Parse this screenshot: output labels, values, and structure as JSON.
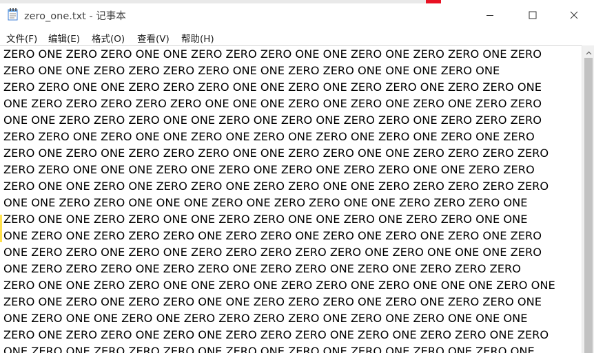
{
  "window": {
    "title": "zero_one.txt - 记事本",
    "controls": {
      "minimize_icon": "minimize-icon",
      "maximize_icon": "maximize-icon",
      "close_icon": "close-icon"
    }
  },
  "menu": [
    {
      "label": "文件(F)"
    },
    {
      "label": "编辑(E)"
    },
    {
      "label": "格式(O)"
    },
    {
      "label": "查看(V)"
    },
    {
      "label": "帮助(H)"
    }
  ],
  "editor": {
    "lines": [
      "ZERO ONE ZERO ZERO ONE ONE ZERO ZERO ZERO ONE ONE ZERO ONE ZERO ZERO ONE ZERO",
      "ZERO ONE ONE ZERO ZERO ZERO ZERO ONE ONE ZERO ZERO ONE ONE ONE ZERO ONE",
      "ZERO ZERO ONE ONE ZERO ZERO ZERO ONE ONE ZERO ONE ZERO ZERO ONE ZERO ZERO ONE",
      "ONE ZERO ZERO ZERO ZERO ZERO ONE ONE ONE ZERO ONE ZERO ONE ZERO ONE ZERO ZERO",
      "ONE ONE ZERO ZERO ZERO ONE ONE ZERO ONE ZERO ONE ZERO ZERO ONE ZERO ZERO ZERO",
      "ZERO ZERO ONE ZERO ONE ONE ZERO ONE ZERO ONE ZERO ONE ZERO ONE ZERO ONE ZERO",
      "ZERO ONE ZERO ONE ZERO ZERO ZERO ONE ONE ZERO ZERO ONE ONE ZERO ZERO ZERO ZERO",
      "ZERO ZERO ONE ONE ONE ZERO ONE ZERO ONE ZERO ONE ZERO ZERO ONE ONE ZERO ZERO",
      "ZERO ONE ONE ZERO ONE ZERO ZERO ONE ZERO ZERO ONE ONE ZERO ZERO ZERO ZERO ZERO",
      "ONE ONE ZERO ZERO ONE ONE ONE ZERO ONE ZERO ZERO ONE ONE ZERO ZERO ZERO ONE",
      "ZERO ONE ONE ZERO ZERO ONE ONE ZERO ZERO ONE ONE ZERO ONE ZERO ZERO ONE ONE",
      "ONE ZERO ONE ZERO ZERO ZERO ONE ZERO ZERO ONE ZERO ONE ZERO ONE ZERO ONE ZERO",
      "ONE ZERO ZERO ONE ZERO ONE ZERO ZERO ZERO ZERO ZERO ONE ZERO ONE ONE ONE ZERO",
      "ONE ZERO ZERO ZERO ONE ZERO ZERO ONE ZERO ZERO ONE ZERO ONE ZERO ZERO ZERO",
      "ZERO ONE ONE ZERO ZERO ONE ONE ZERO ONE ZERO ZERO ONE ZERO ONE ONE ONE ZERO ONE",
      "ZERO ONE ZERO ONE ZERO ZERO ONE ONE ZERO ZERO ZERO ONE ZERO ONE ZERO ZERO ONE",
      "ONE ZERO ONE ONE ZERO ONE ZERO ZERO ZERO ZERO ONE ZERO ONE ZERO ONE ONE ONE",
      "ZERO ONE ZERO ZERO ONE ZERO ONE ZERO ZERO ZERO ONE ZERO ONE ZERO ZERO ONE ZERO",
      "ONE ZERO ONE ZERO ZERO ZERO ONE ZERO ONE ZERO ONE ZERO ONE ZERO ONE ZERO ONE"
    ]
  },
  "colors": {
    "text": "#000000",
    "window_bg": "#ffffff",
    "close_accent": "#e81123",
    "scroll_thumb": "#c2c2c2"
  }
}
